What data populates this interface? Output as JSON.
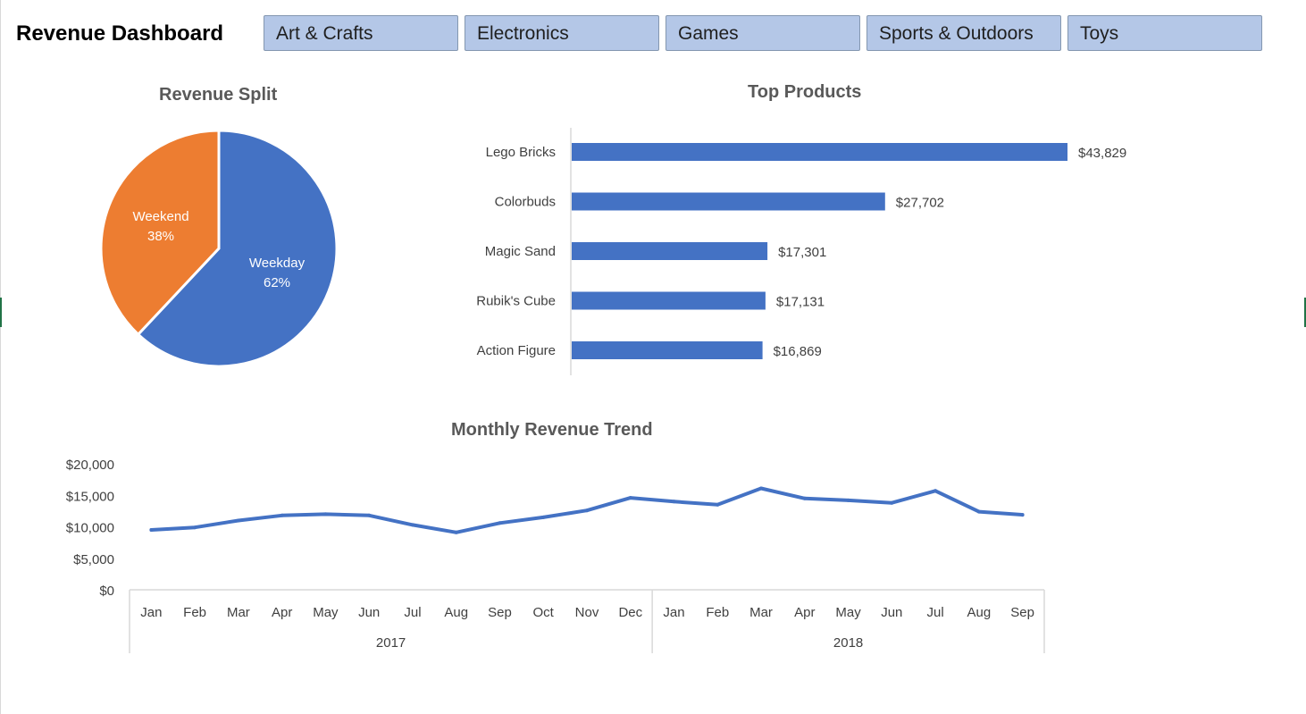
{
  "header": {
    "title": "Revenue Dashboard",
    "slicers": [
      "Art & Crafts",
      "Electronics",
      "Games",
      "Sports & Outdoors",
      "Toys"
    ]
  },
  "colors": {
    "blue": "#4472c4",
    "orange": "#ed7d31",
    "slicer_fill": "#b4c7e7",
    "text": "#595959"
  },
  "chart_data": [
    {
      "type": "pie",
      "title": "Revenue Split",
      "labels": [
        "Weekday",
        "Weekend"
      ],
      "values": [
        62,
        38
      ],
      "value_labels": [
        "62%",
        "38%"
      ],
      "colors": [
        "#4472c4",
        "#ed7d31"
      ]
    },
    {
      "type": "bar",
      "orientation": "horizontal",
      "title": "Top Products",
      "categories": [
        "Lego Bricks",
        "Colorbuds",
        "Magic Sand",
        "Rubik's Cube",
        "Action Figure"
      ],
      "values": [
        43829,
        27702,
        17301,
        17131,
        16869
      ],
      "data_labels": [
        "$43,829",
        "$27,702",
        "$17,301",
        "$17,131",
        "$16,869"
      ],
      "color": "#4472c4"
    },
    {
      "type": "line",
      "title": "Monthly Revenue Trend",
      "x": [
        "Jan",
        "Feb",
        "Mar",
        "Apr",
        "May",
        "Jun",
        "Jul",
        "Aug",
        "Sep",
        "Oct",
        "Nov",
        "Dec",
        "Jan",
        "Feb",
        "Mar",
        "Apr",
        "May",
        "Jun",
        "Jul",
        "Aug",
        "Sep"
      ],
      "x_groups": [
        {
          "label": "2017",
          "count": 12
        },
        {
          "label": "2018",
          "count": 9
        }
      ],
      "values": [
        9500,
        9900,
        11000,
        11800,
        12000,
        11800,
        10300,
        9100,
        10600,
        11500,
        12600,
        14600,
        14000,
        13500,
        16100,
        14500,
        14200,
        13800,
        15700,
        12400,
        11900
      ],
      "ylim": [
        0,
        20000
      ],
      "yticks": [
        0,
        5000,
        10000,
        15000,
        20000
      ],
      "ytick_labels": [
        "$0",
        "$5,000",
        "$10,000",
        "$15,000",
        "$20,000"
      ],
      "color": "#4472c4"
    }
  ]
}
